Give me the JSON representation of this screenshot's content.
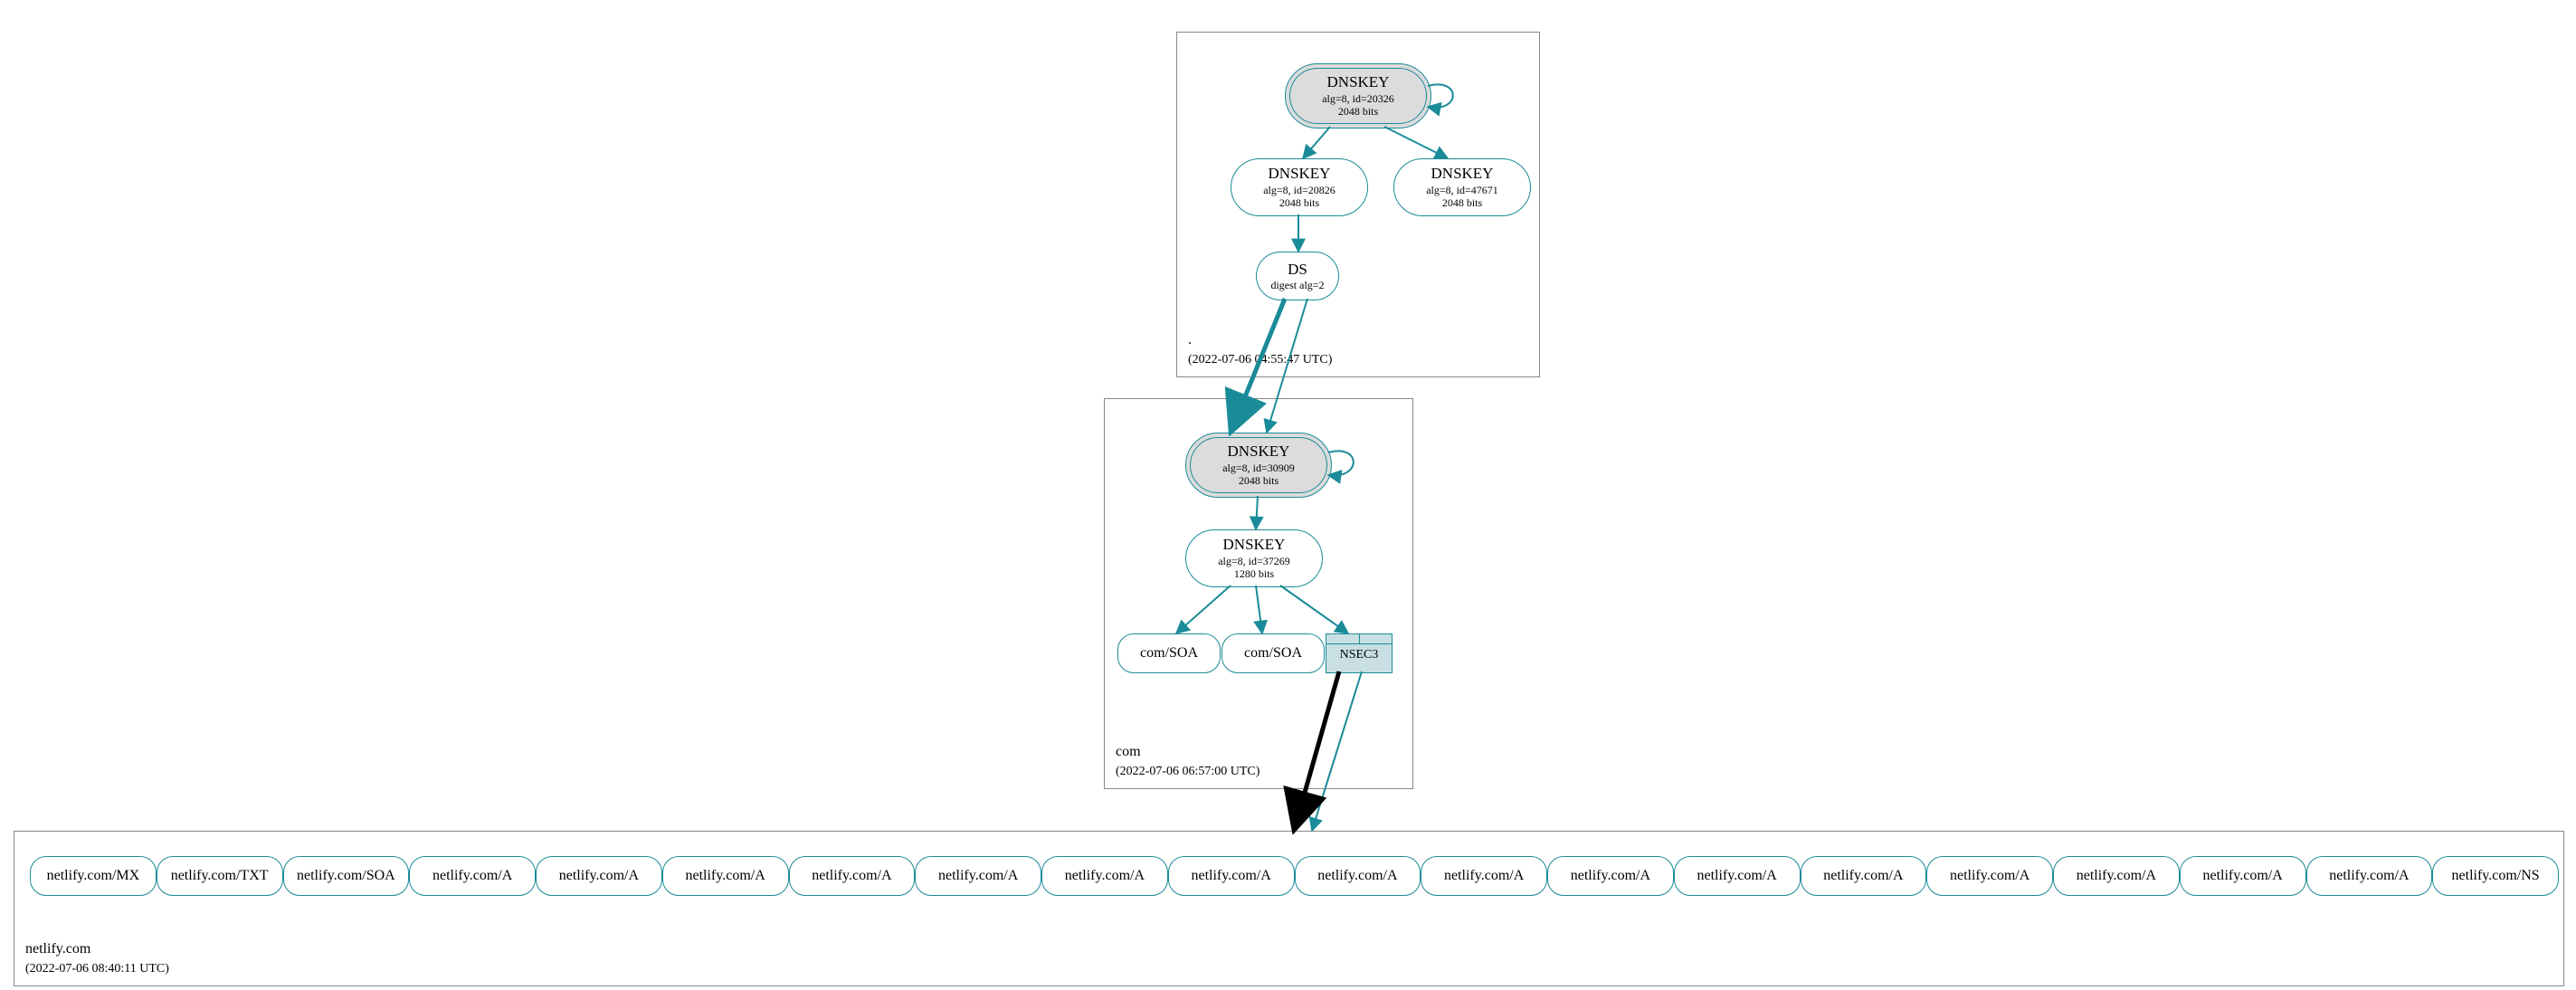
{
  "zones": {
    "root": {
      "name": ".",
      "timestamp": "(2022-07-06 04:55:47 UTC)"
    },
    "com": {
      "name": "com",
      "timestamp": "(2022-07-06 06:57:00 UTC)"
    },
    "netlify": {
      "name": "netlify.com",
      "timestamp": "(2022-07-06 08:40:11 UTC)"
    }
  },
  "root_nodes": {
    "ksk": {
      "title": "DNSKEY",
      "sub1": "alg=8, id=20326",
      "sub2": "2048 bits"
    },
    "zsk": {
      "title": "DNSKEY",
      "sub1": "alg=8, id=20826",
      "sub2": "2048 bits"
    },
    "zsk2": {
      "title": "DNSKEY",
      "sub1": "alg=8, id=47671",
      "sub2": "2048 bits"
    },
    "ds": {
      "title": "DS",
      "sub1": "digest alg=2"
    }
  },
  "com_nodes": {
    "ksk": {
      "title": "DNSKEY",
      "sub1": "alg=8, id=30909",
      "sub2": "2048 bits"
    },
    "zsk": {
      "title": "DNSKEY",
      "sub1": "alg=8, id=37269",
      "sub2": "1280 bits"
    },
    "soa1": {
      "label": "com/SOA"
    },
    "soa2": {
      "label": "com/SOA"
    },
    "nsec3": {
      "label": "NSEC3"
    }
  },
  "netlify_records": [
    "netlify.com/MX",
    "netlify.com/TXT",
    "netlify.com/SOA",
    "netlify.com/A",
    "netlify.com/A",
    "netlify.com/A",
    "netlify.com/A",
    "netlify.com/A",
    "netlify.com/A",
    "netlify.com/A",
    "netlify.com/A",
    "netlify.com/A",
    "netlify.com/A",
    "netlify.com/A",
    "netlify.com/A",
    "netlify.com/A",
    "netlify.com/A",
    "netlify.com/A",
    "netlify.com/A",
    "netlify.com/NS"
  ],
  "colors": {
    "stroke": "#1a8b98",
    "black": "#000000"
  }
}
